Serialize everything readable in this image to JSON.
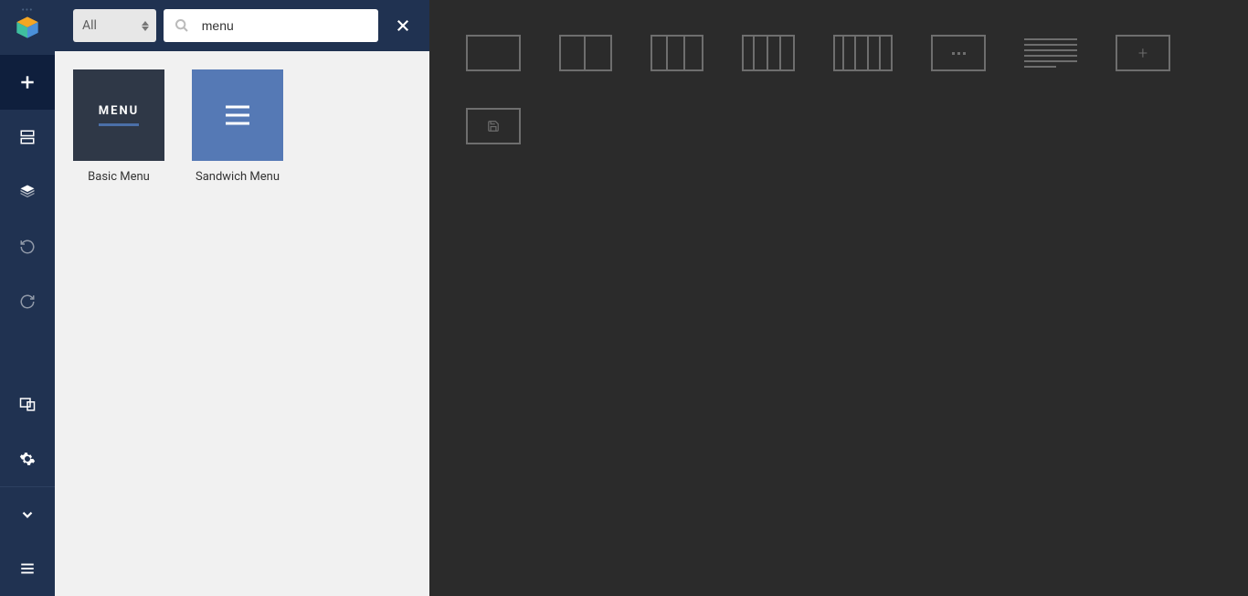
{
  "filter": {
    "label": "All"
  },
  "search": {
    "value": "menu",
    "placeholder": ""
  },
  "elements": [
    {
      "label": "Basic Menu",
      "thumb_text": "MENU"
    },
    {
      "label": "Sandwich Menu"
    }
  ]
}
